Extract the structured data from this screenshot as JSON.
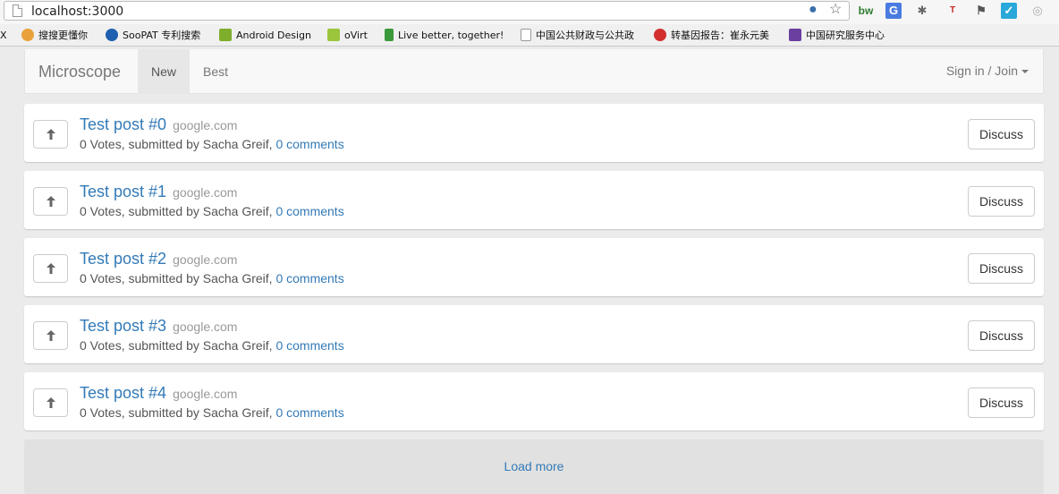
{
  "browser": {
    "url": "localhost:3000",
    "bookmarks": [
      {
        "label": "X"
      },
      {
        "label": "搜搜更懂你"
      },
      {
        "label": "SooPAT 专利搜索"
      },
      {
        "label": "Android Design"
      },
      {
        "label": "oVirt"
      },
      {
        "label": "Live better, together!"
      },
      {
        "label": "中国公共财政与公共政"
      },
      {
        "label": "转基因报告：崔永元美"
      },
      {
        "label": "中国研究服务中心"
      }
    ],
    "extensions": [
      "bw",
      "G",
      "T"
    ]
  },
  "nav": {
    "brand": "Microscope",
    "tabs": [
      {
        "label": "New"
      },
      {
        "label": "Best"
      }
    ],
    "signin": "Sign in / Join"
  },
  "posts": [
    {
      "title": "Test post #0",
      "domain": "google.com",
      "meta": "0 Votes, submitted by Sacha Greif,",
      "comments": "0 comments",
      "action": "Discuss"
    },
    {
      "title": "Test post #1",
      "domain": "google.com",
      "meta": "0 Votes, submitted by Sacha Greif,",
      "comments": "0 comments",
      "action": "Discuss"
    },
    {
      "title": "Test post #2",
      "domain": "google.com",
      "meta": "0 Votes, submitted by Sacha Greif,",
      "comments": "0 comments",
      "action": "Discuss"
    },
    {
      "title": "Test post #3",
      "domain": "google.com",
      "meta": "0 Votes, submitted by Sacha Greif,",
      "comments": "0 comments",
      "action": "Discuss"
    },
    {
      "title": "Test post #4",
      "domain": "google.com",
      "meta": "0 Votes, submitted by Sacha Greif,",
      "comments": "0 comments",
      "action": "Discuss"
    }
  ],
  "load_more": "Load more",
  "colors": {
    "link": "#337ab7",
    "muted": "#999999",
    "navbar_bg": "#f8f8f8"
  }
}
